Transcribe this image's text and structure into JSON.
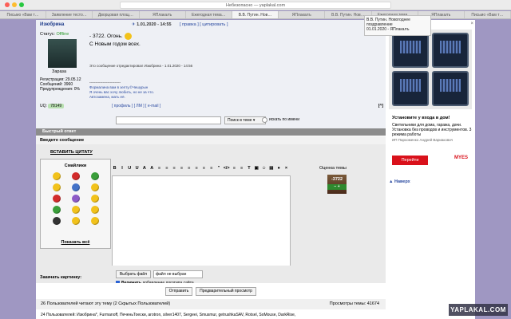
{
  "browser": {
    "url_text": "Небезопасно — yaplakal.com",
    "tabs": [
      "Письмо «Вам т…",
      "Заявление тесто…",
      "Дворцовая площ…",
      "ЯПлакалъ",
      "Ежегодная тема…",
      "В.В. Путин. Нов…",
      "ЯПлакалъ",
      "В.В. Путин. Нов…",
      "Ежегодная тема…",
      "ЯПлакалъ",
      "Письмо «Вам т…"
    ],
    "active_tab": 5
  },
  "tooltip": {
    "line1": "В.В. Путин. Новогоднее поздравление",
    "line2": "01.01.2020 - ЯПлакалъ"
  },
  "post": {
    "author": "Изюбрина",
    "time_label": "1.01.2020 - 14:55",
    "links": "[ правка ] [ цитировать ]",
    "status_label": "Статус:",
    "status_value": "Offline",
    "avatar_caption": "Зараза",
    "reg_lines": [
      "Регистрация: 29.05.12",
      "Сообщений: 3960",
      "Предупреждения: 0%"
    ],
    "text_line1": "- 3722. Огонь.",
    "text_line2": "С Новым годом всех.",
    "edited": "Это сообщение отредактировал Изюбрина - 1.01.2020 - 14:56",
    "sig_line0": "--------------------------",
    "sig_line1": "Формалина вам в зелту.©Чешурын",
    "sig_line2": "Я очень вас хочу любить, но не за что.",
    "sig_line3": "Автозаменa, мать её.",
    "uq_label": "UQ:",
    "uq_value": "78149",
    "profile_links": "[ профиль ] [ ЛМ ] [ e-mail ]",
    "corner_btn": "[^]"
  },
  "search": {
    "option": "Поиск в теме",
    "checkbox_label": "искать по имени"
  },
  "reply": {
    "bar": "Быстрый ответ",
    "subbar": "Введите сообщение",
    "insert_quote": "ВСТАВИТЬ ЦИТАТУ",
    "smileys_title": "Смайлики",
    "show_all": "Показать всё",
    "toolbar": [
      "B",
      "I",
      "U",
      "U",
      "A",
      "A",
      "≡",
      "≡",
      "≡",
      "≡",
      "≡",
      "≡",
      "≡",
      "≡",
      "\"",
      "</>",
      "≡",
      "≡",
      "T",
      "▣",
      "☺",
      "▤",
      "●",
      "×"
    ],
    "rating_label": "Оценка темы",
    "rating_value": "-3722",
    "rating_minus": "−",
    "rating_plus": "+"
  },
  "upload": {
    "label": "Закачать картинку:",
    "file_button": "Выбрать файл",
    "file_name": "файл не выбран",
    "logo_bold": "Включить",
    "logo_rest": "добавление логотипа сайта"
  },
  "actions": {
    "send": "Отправить",
    "preview": "Предварительный просмотр"
  },
  "stats": {
    "readers": "26 Пользователей читают эту тему (2 Скрытых Пользователей)",
    "views": "Просмотры темы: 41674",
    "users": "24 Пользователей: Изюбрина*, Furmanoff, ПеченьТоески, arotron, silver1407, Sergeei, Smusmur, getrushkaSAV, Rotsel, SoMouse, DarkRise,"
  },
  "ad": {
    "headline": "Установите у входа в дом!",
    "text": "Светильники для дома, гаража, дачи. Установка без проводов и инструментов. 3 режима работы",
    "source": "ИП Пархоменко Андрей Вариакович",
    "button": "Перейти",
    "logo": "MYES",
    "close": "×"
  },
  "nav": {
    "up": "▲ Наверх"
  },
  "watermark": "YAPLAKAL.COM"
}
